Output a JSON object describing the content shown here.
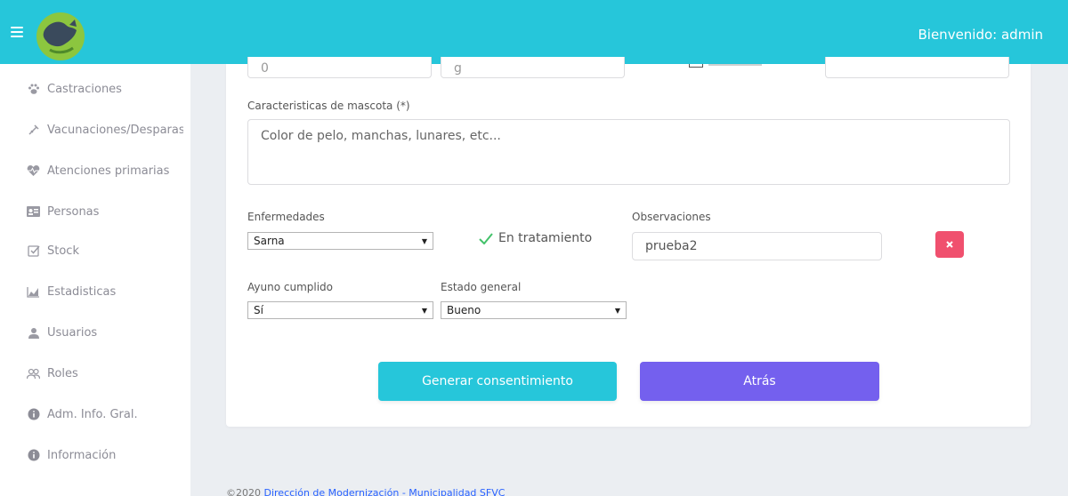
{
  "header": {
    "welcome": "Bienvenido: admin"
  },
  "sidebar": {
    "items": [
      {
        "label": "Castraciones",
        "icon": "paw-icon"
      },
      {
        "label": "Vacunaciones/Desparasitaciones",
        "icon": "syringe-icon"
      },
      {
        "label": "Atenciones primarias",
        "icon": "heartbeat-icon"
      },
      {
        "label": "Personas",
        "icon": "id-card-icon"
      },
      {
        "label": "Stock",
        "icon": "checkbox-icon"
      },
      {
        "label": "Estadisticas",
        "icon": "chart-icon"
      },
      {
        "label": "Usuarios",
        "icon": "user-icon"
      },
      {
        "label": "Roles",
        "icon": "users-icon"
      },
      {
        "label": "Adm. Info. Gral.",
        "icon": "info-icon"
      },
      {
        "label": "Información",
        "icon": "info-icon"
      }
    ]
  },
  "form": {
    "top_row": {
      "field1_value": "0",
      "field2_value": "g"
    },
    "characteristics": {
      "label": "Caracteristicas de mascota (*)",
      "placeholder": "Color de pelo, manchas, lunares, etc..."
    },
    "diseases": {
      "label": "Enfermedades",
      "selected": "Sarna",
      "treatment_label": "En tratamiento",
      "observations_label": "Observaciones",
      "observations_value": "prueba2"
    },
    "fasting": {
      "label": "Ayuno cumplido",
      "selected": "Sí"
    },
    "general_state": {
      "label": "Estado general",
      "selected": "Bueno"
    },
    "buttons": {
      "consent": "Generar consentimiento",
      "back": "Atrás"
    }
  },
  "footer": {
    "prefix": "©2020",
    "link": "Dirección de Modernización - Municipalidad SFVC"
  },
  "colors": {
    "topbar": "#26c6da",
    "primary_button": "#26c6da",
    "back_button": "#7460ee",
    "delete_button": "#f0506e"
  }
}
